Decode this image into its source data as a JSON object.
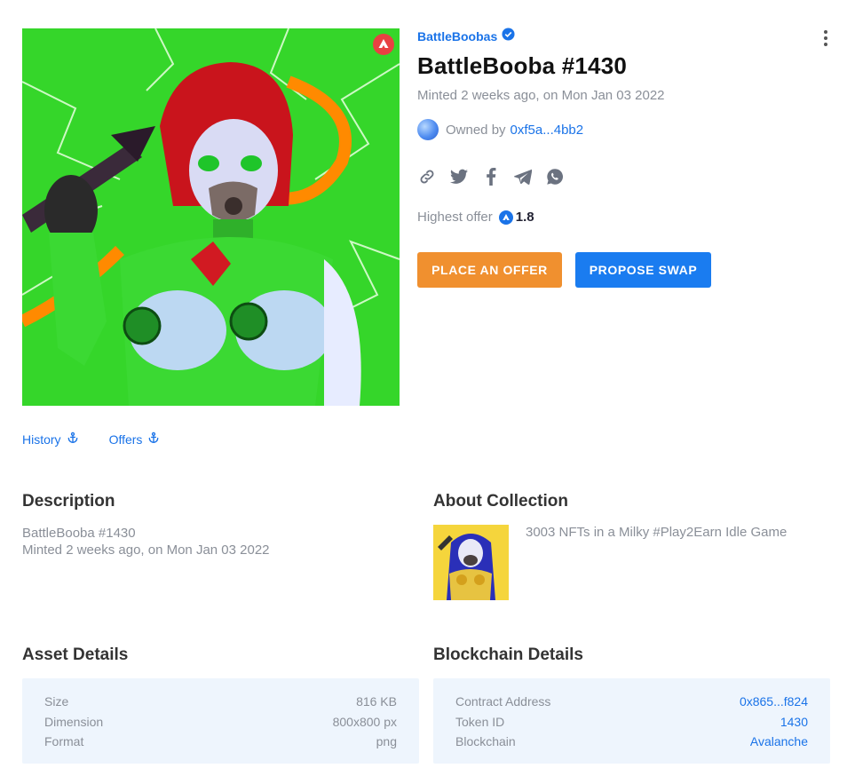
{
  "nft": {
    "collection_name": "BattleBoobas",
    "title": "BattleBooba #1430",
    "minted": "Minted 2 weeks ago, on Mon Jan 03 2022",
    "owned_by_label": "Owned by",
    "owner_address": "0xf5a...4bb2",
    "highest_offer_label": "Highest offer",
    "highest_offer_value": "1.8"
  },
  "actions": {
    "place_offer": "PLACE AN OFFER",
    "propose_swap": "PROPOSE SWAP"
  },
  "anchors": {
    "history": "History",
    "offers": "Offers"
  },
  "description": {
    "heading": "Description",
    "line1": "BattleBooba #1430",
    "line2": "Minted 2 weeks ago, on Mon Jan 03 2022"
  },
  "about_collection": {
    "heading": "About Collection",
    "text": "3003 NFTs in a Milky #Play2Earn Idle Game"
  },
  "asset_details": {
    "heading": "Asset Details",
    "rows": [
      {
        "label": "Size",
        "value": "816 KB"
      },
      {
        "label": "Dimension",
        "value": "800x800 px"
      },
      {
        "label": "Format",
        "value": "png"
      }
    ]
  },
  "blockchain_details": {
    "heading": "Blockchain Details",
    "rows": [
      {
        "label": "Contract Address",
        "value": "0x865...f824"
      },
      {
        "label": "Token ID",
        "value": "1430"
      },
      {
        "label": "Blockchain",
        "value": "Avalanche"
      }
    ]
  },
  "colors": {
    "link_blue": "#1a73e8",
    "offer_orange": "#f0902f",
    "swap_blue": "#1a7cf0",
    "avalanche_red": "#e84142",
    "details_bg": "#eef5fd"
  },
  "icons": [
    "verified-badge-icon",
    "kebab-menu-icon",
    "link-icon",
    "twitter-icon",
    "facebook-icon",
    "telegram-icon",
    "whatsapp-icon",
    "avalanche-icon",
    "anchor-icon"
  ]
}
